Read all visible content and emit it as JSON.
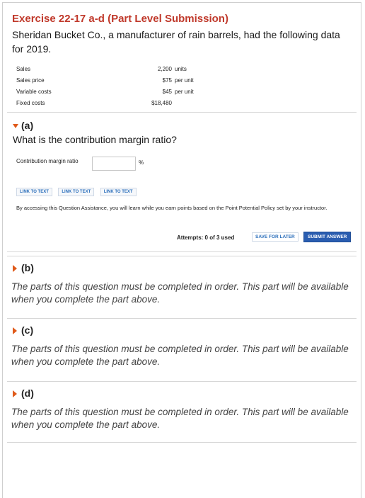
{
  "exercise": {
    "title": "Exercise 22-17 a-d (Part Level Submission)",
    "intro": "Sheridan Bucket Co., a manufacturer of rain barrels, had the following data for 2019."
  },
  "data_table": [
    {
      "label": "Sales",
      "value": "2,200",
      "unit": "units"
    },
    {
      "label": "Sales price",
      "value": "$75",
      "unit": "per unit"
    },
    {
      "label": "Variable costs",
      "value": "$45",
      "unit": "per unit"
    },
    {
      "label": "Fixed costs",
      "value": "$18,480",
      "unit": ""
    }
  ],
  "part_a": {
    "label": "(a)",
    "question": "What is the contribution margin ratio?",
    "input_label": "Contribution margin ratio",
    "input_value": "",
    "percent_symbol": "%",
    "links": [
      "LINK TO TEXT",
      "LINK TO TEXT",
      "LINK TO TEXT"
    ],
    "notice": "By accessing this Question Assistance, you will learn while you earn points based on the Point Potential Policy set by your instructor.",
    "attempts": "Attempts: 0 of 3 used",
    "save_label": "SAVE FOR LATER",
    "submit_label": "SUBMIT ANSWER"
  },
  "locked_parts": [
    {
      "label": "(b)",
      "text": "The parts of this question must be completed in order. This part will be available when you complete the part above."
    },
    {
      "label": "(c)",
      "text": "The parts of this question must be completed in order. This part will be available when you complete the part above."
    },
    {
      "label": "(d)",
      "text": "The parts of this question must be completed in order. This part will be available when you complete the part above."
    }
  ],
  "colors": {
    "title": "#c0392b",
    "arrow": "#e05a1a",
    "link": "#2a6ebb",
    "submit_bg": "#2a5db0"
  }
}
